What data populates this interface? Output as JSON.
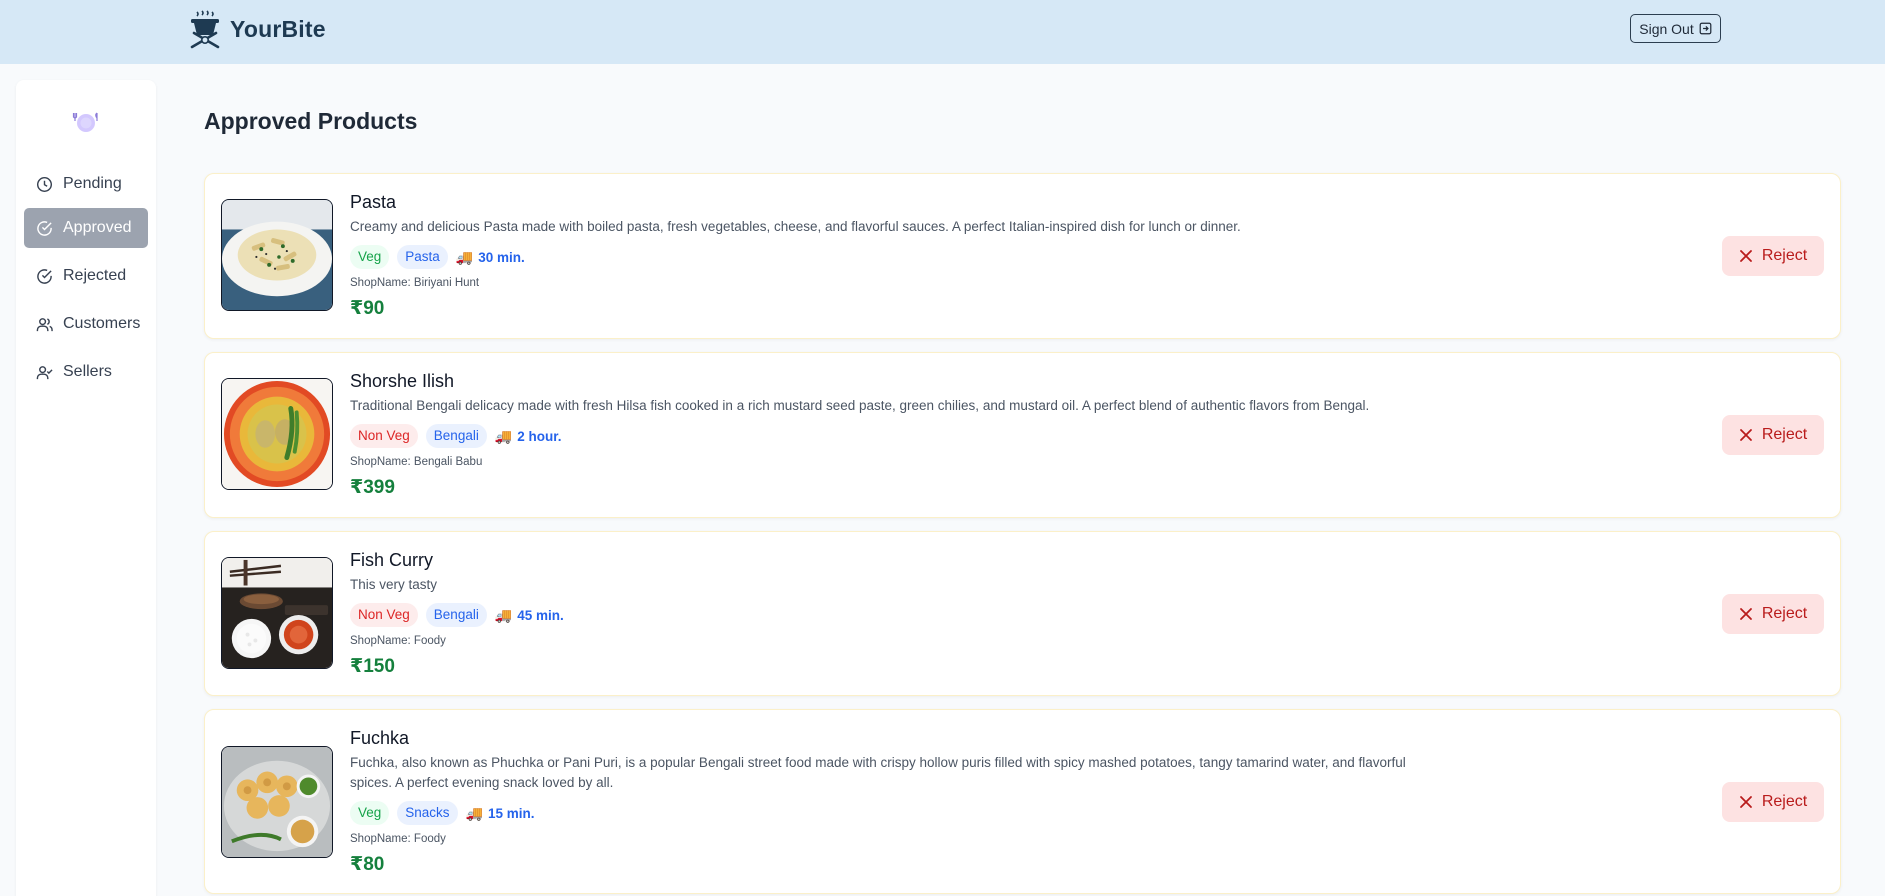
{
  "brand": {
    "name": "YourBite",
    "logo_icon": "chef-grill-logo"
  },
  "header": {
    "signout_label": "Sign Out",
    "signout_icon": "sign-out-icon"
  },
  "sidebar": {
    "logo_icon": "plate-icon",
    "items": [
      {
        "label": "Pending",
        "icon": "clock-icon",
        "active": false
      },
      {
        "label": "Approved",
        "icon": "check-circle-icon",
        "active": true
      },
      {
        "label": "Rejected",
        "icon": "check-circle-icon",
        "active": false
      },
      {
        "label": "Customers",
        "icon": "users-icon",
        "active": false
      },
      {
        "label": "Sellers",
        "icon": "user-check-icon",
        "active": false
      }
    ]
  },
  "page": {
    "title": "Approved Products"
  },
  "products": [
    {
      "name": "Pasta",
      "description": "Creamy and delicious Pasta made with boiled pasta, fresh vegetables, cheese, and flavorful sauces. A perfect Italian-inspired dish for lunch or dinner.",
      "diet": "Veg",
      "category": "Pasta",
      "time": "30 min.",
      "shop": "ShopName: Biriyani Hunt",
      "price": "₹90",
      "reject_label": "Reject"
    },
    {
      "name": "Shorshe Ilish",
      "description": "Traditional Bengali delicacy made with fresh Hilsa fish cooked in a rich mustard seed paste, green chilies, and mustard oil. A perfect blend of authentic flavors from Bengal.",
      "diet": "Non Veg",
      "category": "Bengali",
      "time": "2 hour.",
      "shop": "ShopName: Bengali Babu",
      "price": "₹399",
      "reject_label": "Reject"
    },
    {
      "name": "Fish Curry",
      "description": "This very tasty",
      "diet": "Non Veg",
      "category": "Bengali",
      "time": "45 min.",
      "shop": "ShopName: Foody",
      "price": "₹150",
      "reject_label": "Reject"
    },
    {
      "name": "Fuchka",
      "description": "Fuchka, also known as Phuchka or Pani Puri, is a popular Bengali street food made with crispy hollow puris filled with spicy mashed potatoes, tangy tamarind water, and flavorful spices. A perfect evening snack loved by all.",
      "diet": "Veg",
      "category": "Snacks",
      "time": "15 min.",
      "shop": "ShopName: Foody",
      "price": "₹80",
      "reject_label": "Reject"
    }
  ],
  "colors": {
    "header_bg": "#d6e8f6",
    "active_nav_bg": "#9ca3af",
    "price_green": "#15803d",
    "reject_bg": "#fde2e2",
    "reject_text": "#b91c1c",
    "time_blue": "#2563eb"
  }
}
